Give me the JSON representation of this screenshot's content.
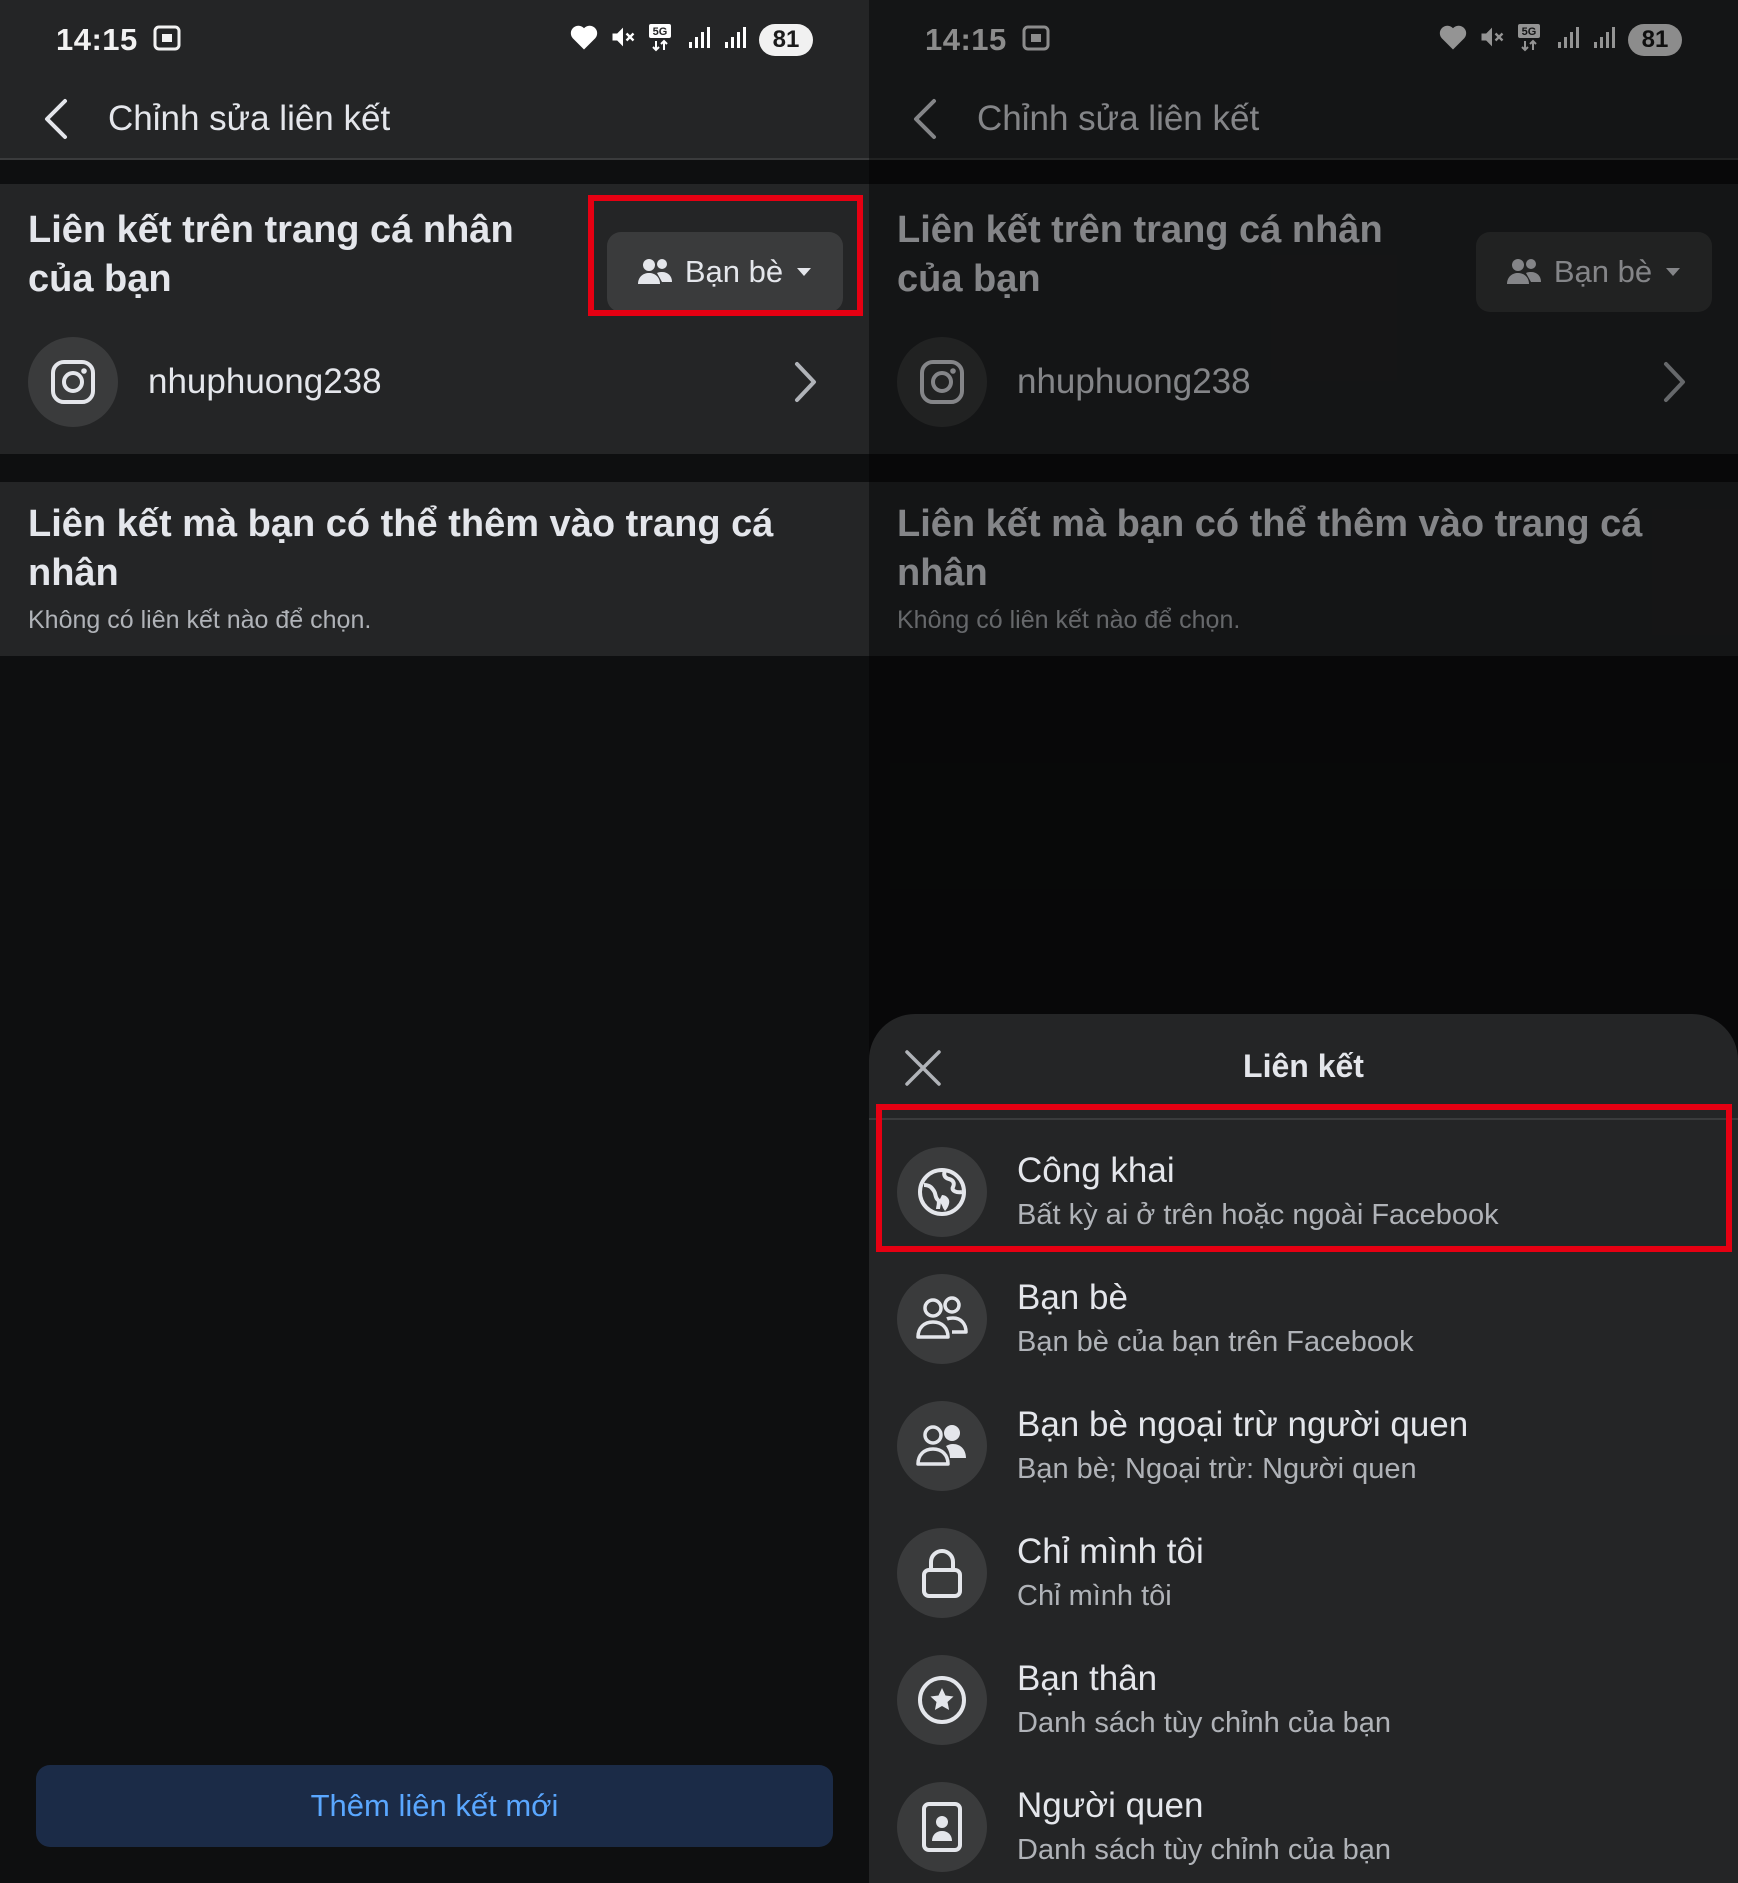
{
  "status_bar": {
    "time": "14:15",
    "battery": "81",
    "network": "5G"
  },
  "app_bar": {
    "title": "Chỉnh sửa liên kết"
  },
  "profile_links": {
    "title": "Liên kết trên trang cá nhân của bạn",
    "audience_label": "Bạn bè",
    "link": {
      "name": "nhuphuong238",
      "icon": "instagram-icon"
    }
  },
  "addable_links": {
    "title": "Liên kết mà bạn có thể thêm vào trang cá nhân",
    "empty_text": "Không có liên kết nào để chọn."
  },
  "add_button_label": "Thêm liên kết mới",
  "sheet": {
    "title": "Liên kết",
    "options": [
      {
        "title": "Công khai",
        "subtitle": "Bất kỳ ai ở trên hoặc ngoài Facebook",
        "icon": "globe-icon"
      },
      {
        "title": "Bạn bè",
        "subtitle": "Bạn bè của bạn trên Facebook",
        "icon": "friends-icon"
      },
      {
        "title": "Bạn bè ngoại trừ người quen",
        "subtitle": "Bạn bè; Ngoại trừ: Người quen",
        "icon": "friends-except-icon"
      },
      {
        "title": "Chỉ mình tôi",
        "subtitle": "Chỉ mình tôi",
        "icon": "lock-icon"
      },
      {
        "title": "Bạn thân",
        "subtitle": "Danh sách tùy chỉnh của bạn",
        "icon": "star-icon"
      },
      {
        "title": "Người quen",
        "subtitle": "Danh sách tùy chỉnh của bạn",
        "icon": "acquaintance-icon"
      }
    ]
  },
  "colors": {
    "highlight": "#e60012",
    "accent": "#5aa7ff",
    "surface": "#242526"
  }
}
